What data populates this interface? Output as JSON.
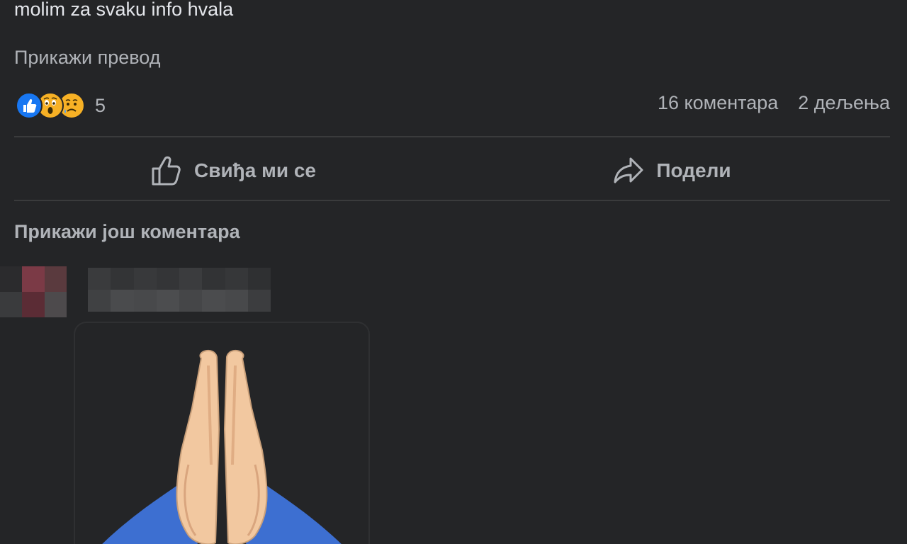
{
  "post": {
    "text": "molim za svaku info hvala",
    "translate_label": "Прикажи превод"
  },
  "reactions": {
    "icons": [
      "like-icon",
      "wow-icon",
      "sad-icon"
    ],
    "count": "5"
  },
  "stats": {
    "comments": "16 коментара",
    "shares": "2 дељења"
  },
  "actions": {
    "like_label": "Свиђа ми се",
    "share_label": "Подели"
  },
  "comments": {
    "more_label": "Прикажи још коментара",
    "sticker_icon": "folded-hands-icon"
  },
  "colors": {
    "background": "#242527",
    "text_primary": "#e4e6eb",
    "text_secondary": "#b0b3b8",
    "like_blue": "#1877f2",
    "emoji_yellow": "#f7b125"
  }
}
